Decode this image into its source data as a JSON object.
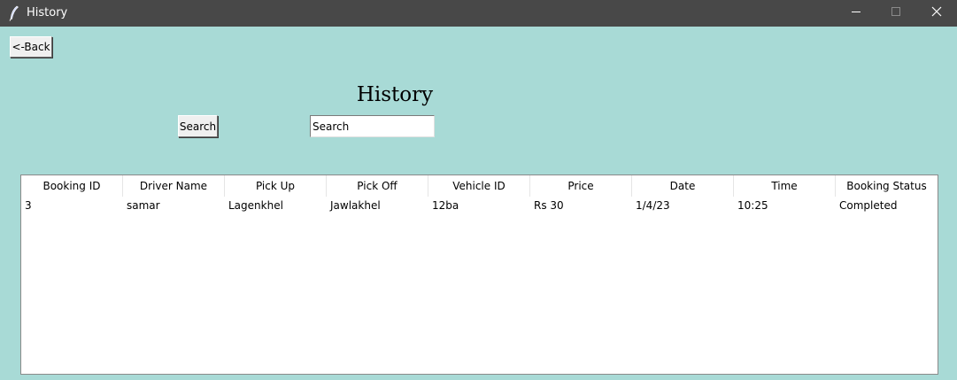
{
  "window": {
    "title": "History",
    "controls": {
      "minimize": "minimize-icon",
      "maximize": "maximize-icon",
      "close": "close-icon"
    }
  },
  "toolbar": {
    "back_label": "<-Back",
    "search_button_label": "Search"
  },
  "page": {
    "title": "History"
  },
  "search": {
    "value": "Search"
  },
  "table": {
    "columns": [
      "Booking ID",
      "Driver Name",
      "Pick Up",
      "Pick Off",
      "Vehicle ID",
      "Price",
      "Date",
      "Time",
      "Booking Status"
    ],
    "rows": [
      [
        "3",
        "samar",
        "Lagenkhel",
        "Jawlakhel",
        "12ba",
        "Rs 30",
        "1/4/23",
        "10:25",
        "Completed"
      ]
    ]
  },
  "colors": {
    "background": "#a8dad6",
    "titlebar": "#484848",
    "table_background": "#ffffff"
  }
}
